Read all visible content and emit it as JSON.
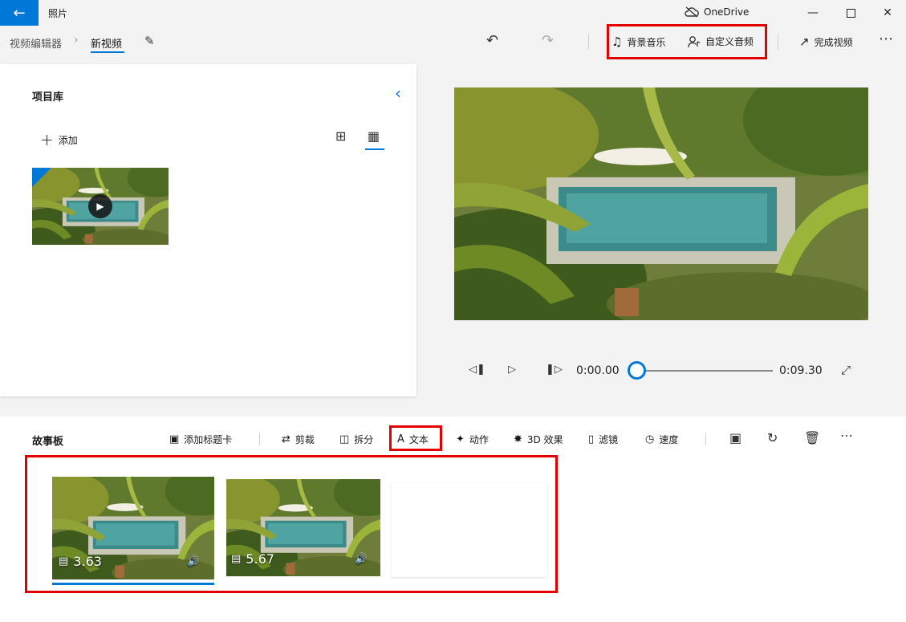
{
  "titlebar": {
    "app_title": "照片",
    "onedrive_label": "OneDrive"
  },
  "toolbar": {
    "breadcrumb_root": "视频编辑器",
    "breadcrumb_current": "新视频",
    "background_music": "背景音乐",
    "custom_audio": "自定义音频",
    "finish_video": "完成视频"
  },
  "library": {
    "title": "项目库",
    "add_label": "添加"
  },
  "playback": {
    "current_time": "0:00.00",
    "total_time": "0:09.30",
    "progress": 0
  },
  "storyboard": {
    "title": "故事板",
    "tools": {
      "add_title_card": "添加标题卡",
      "trim": "剪裁",
      "split": "拆分",
      "text": "文本",
      "motion": "动作",
      "effects_3d": "3D 效果",
      "filters": "滤镜",
      "speed": "速度"
    },
    "clips": [
      {
        "duration": "3.63",
        "selected": true
      },
      {
        "duration": "5.67",
        "selected": false
      }
    ]
  },
  "colors": {
    "accent": "#0078d7",
    "highlight_box": "#e30000"
  }
}
